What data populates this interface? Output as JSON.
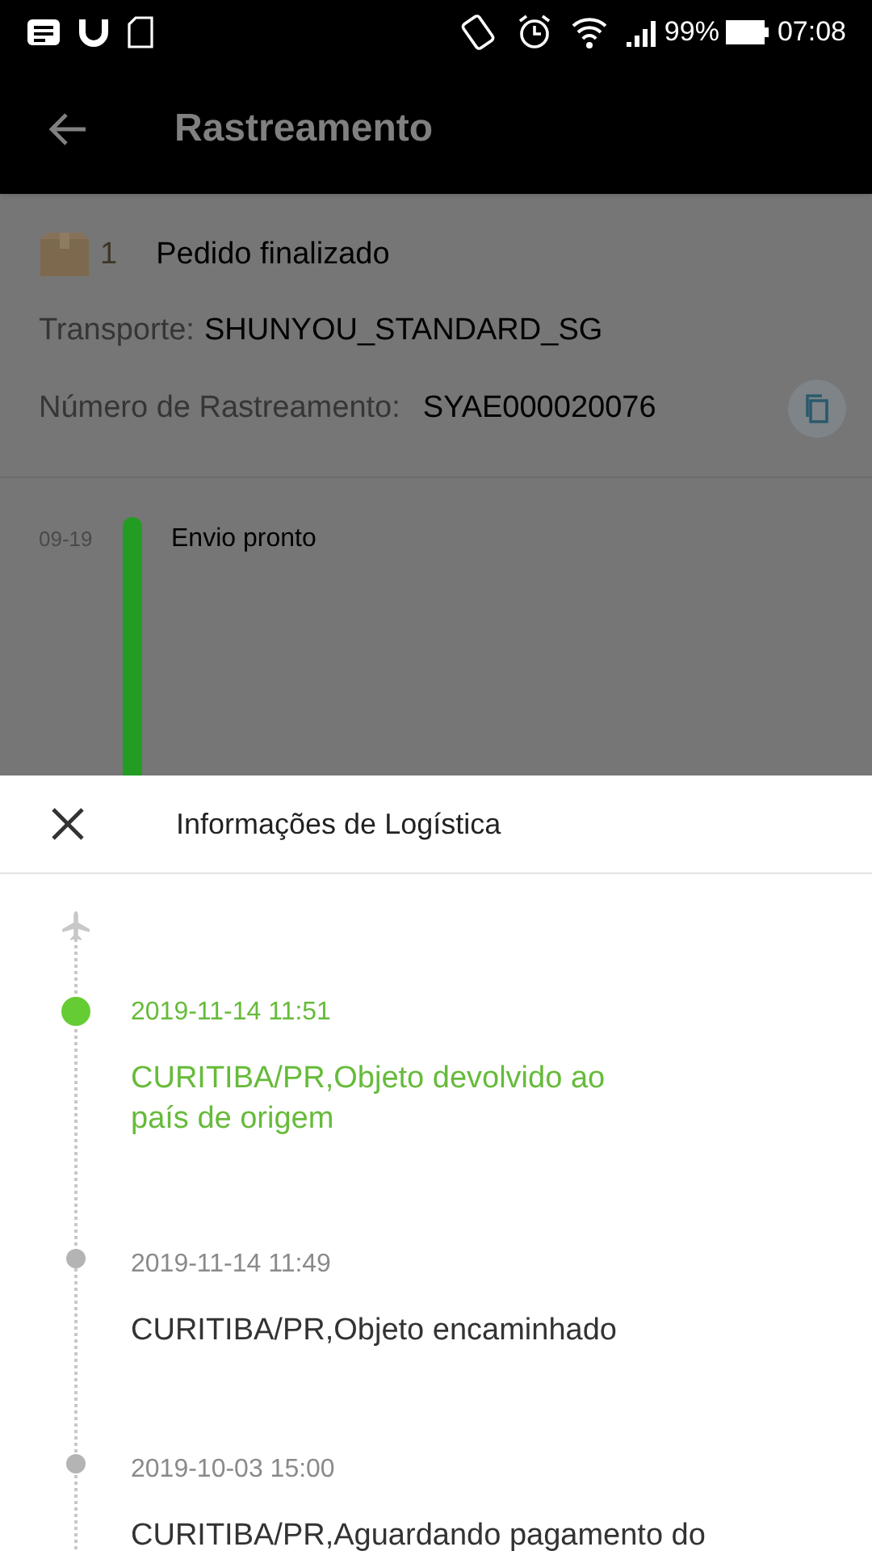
{
  "status_bar": {
    "battery": "99%",
    "time": "07:08"
  },
  "app_bar": {
    "title": "Rastreamento"
  },
  "order": {
    "count": "1",
    "status": "Pedido finalizado",
    "carrier_label": "Transporte:",
    "carrier": "SHUNYOU_STANDARD_SG",
    "tracking_label": "Número de Rastreamento:",
    "tracking_number": "SYAE000020076"
  },
  "summary_timeline": [
    {
      "date": "09-19",
      "event": "Envio pronto"
    }
  ],
  "logistics_sheet": {
    "title": "Informações de Logística",
    "events": [
      {
        "time": "2019-11-14 11:51",
        "description": "CURITIBA/PR,Objeto devolvido ao país de origem",
        "current": true
      },
      {
        "time": "2019-11-14 11:49",
        "description": "CURITIBA/PR,Objeto encaminhado",
        "current": false
      },
      {
        "time": "2019-10-03 15:00",
        "description": "CURITIBA/PR,Aguardando pagamento do",
        "current": false
      }
    ]
  }
}
